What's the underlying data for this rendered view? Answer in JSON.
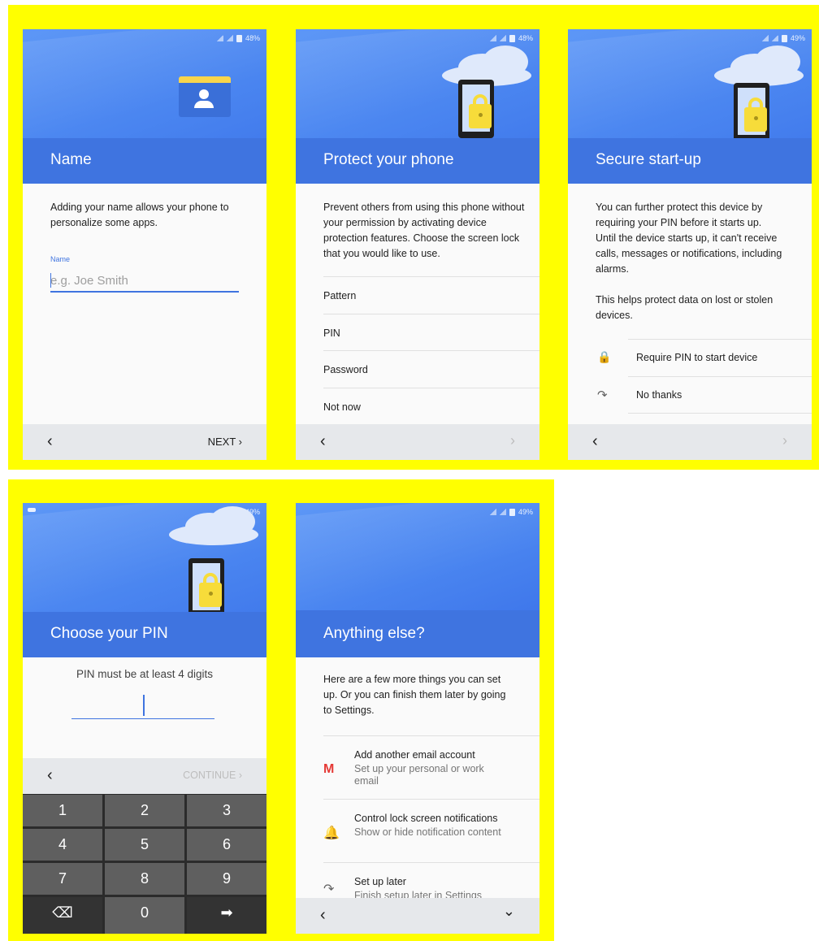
{
  "status": {
    "battery_a": "48%",
    "battery_b": "48%",
    "battery_c": "49%",
    "battery_d": "49%",
    "battery_e": "49%"
  },
  "screen_name": {
    "title": "Name",
    "description": "Adding your name allows your phone to personalize some apps.",
    "field_label": "Name",
    "field_placeholder": "e.g. Joe Smith",
    "back": "‹",
    "next": "NEXT ›"
  },
  "screen_protect": {
    "title": "Protect your phone",
    "description": "Prevent others from using this phone without your permission by activating device protection features. Choose the screen lock that you would like to use.",
    "options": [
      "Pattern",
      "PIN",
      "Password",
      "Not now"
    ],
    "back": "‹",
    "forward": "›"
  },
  "screen_secure": {
    "title": "Secure start-up",
    "description": "You can further protect this device by requiring your PIN before it starts up. Until the device starts up, it can't receive calls, messages or notifications, including alarms.",
    "description2": "This helps protect data on lost or stolen devices.",
    "option_require": "Require PIN to start device",
    "option_no": "No thanks",
    "back": "‹",
    "forward": "›"
  },
  "screen_pin": {
    "title": "Choose your PIN",
    "hint": "PIN must be at least 4 digits",
    "back": "‹",
    "continue": "CONTINUE ›",
    "keys": [
      "1",
      "2",
      "3",
      "4",
      "5",
      "6",
      "7",
      "8",
      "9",
      "0"
    ],
    "delete_key": "⌫",
    "enter_key": "➡"
  },
  "screen_else": {
    "title": "Anything else?",
    "description": "Here are a few more things you can set up. Or you can finish them later by going to Settings.",
    "items": [
      {
        "title": "Add another email account",
        "subtitle": "Set up your personal or work email"
      },
      {
        "title": "Control lock screen notifications",
        "subtitle": "Show or hide notification content"
      },
      {
        "title": "Set up later",
        "subtitle": "Finish setup later in Settings"
      }
    ],
    "back": "‹",
    "more": "⌄"
  },
  "colors": {
    "highlight": "#ffff00",
    "hero": "#4a85f0",
    "titlebar": "#3f74e0",
    "accent": "#3f74e0"
  }
}
